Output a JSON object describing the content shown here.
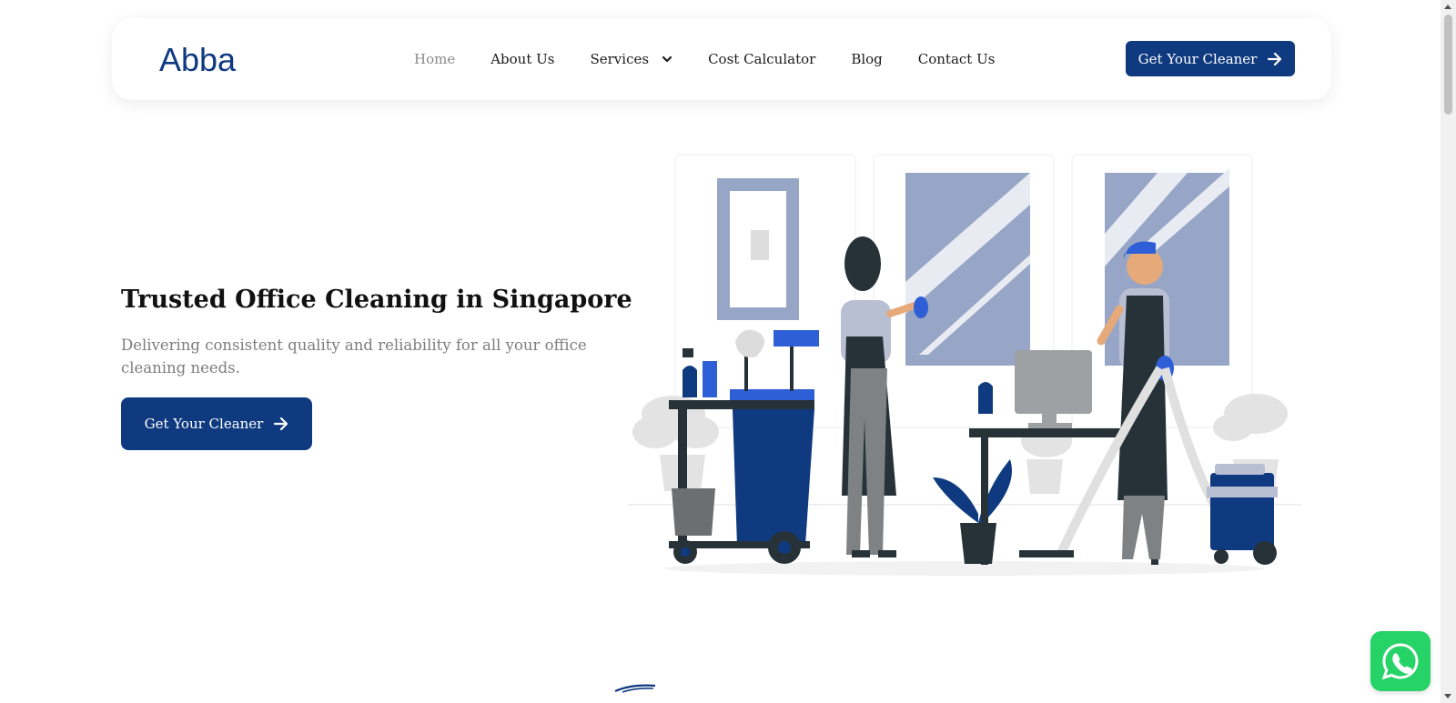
{
  "header": {
    "logo_text": "Abba",
    "nav": [
      {
        "label": "Home",
        "active": true
      },
      {
        "label": "About Us"
      },
      {
        "label": "Services",
        "dropdown": true
      },
      {
        "label": "Cost Calculator"
      },
      {
        "label": "Blog"
      },
      {
        "label": "Contact Us"
      }
    ],
    "cta_label": "Get Your Cleaner"
  },
  "hero": {
    "title": "Trusted Office Cleaning in Singapore",
    "subtitle": "Delivering consistent quality and reliability for all your office cleaning needs.",
    "cta_label": "Get Your Cleaner"
  },
  "icons": {
    "whatsapp": "whatsapp-icon",
    "arrow": "arrow-right-icon",
    "chevron": "chevron-down-icon"
  },
  "colors": {
    "brand": "#0f3a80",
    "nav_active": "#8a8a8a",
    "whatsapp": "#25d366",
    "illustration_light": "#97a6c6",
    "illustration_blue": "#2f5fd6"
  }
}
